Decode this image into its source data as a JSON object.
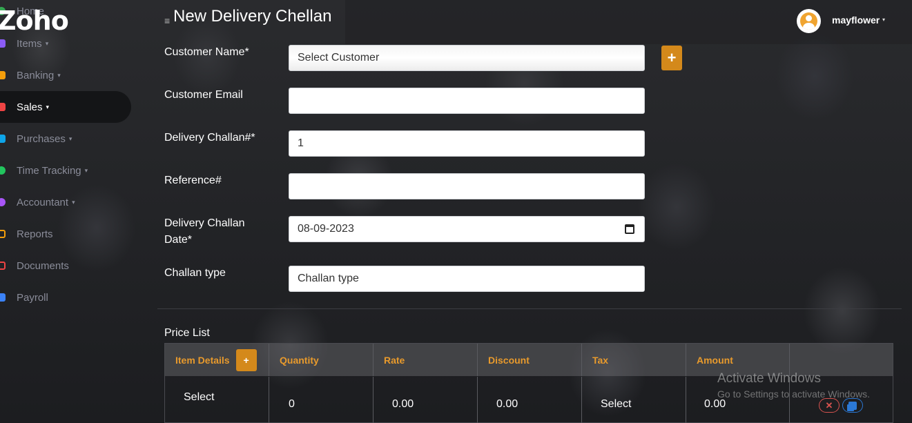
{
  "brand": "Zoho",
  "sidebar": {
    "items": [
      {
        "label": "Home",
        "caret": "",
        "icon": "home-icon",
        "color": "#35a853"
      },
      {
        "label": "Items",
        "caret": "▾",
        "icon": "items-icon",
        "color": "#8b5cf6"
      },
      {
        "label": "Banking",
        "caret": "▾",
        "icon": "bank-icon",
        "color": "#f59e0b"
      },
      {
        "label": "Sales",
        "caret": "▾",
        "icon": "sales-icon",
        "color": "#ef4444"
      },
      {
        "label": "Purchases",
        "caret": "▾",
        "icon": "cart-icon",
        "color": "#0ea5e9"
      },
      {
        "label": "Time Tracking",
        "caret": "▾",
        "icon": "clock-icon",
        "color": "#22c55e"
      },
      {
        "label": "Accountant",
        "caret": "▾",
        "icon": "user-icon",
        "color": "#a855f7"
      },
      {
        "label": "Reports",
        "caret": "",
        "icon": "calendar-icon",
        "color": "#f59e0b"
      },
      {
        "label": "Documents",
        "caret": "",
        "icon": "folder-icon",
        "color": "#ef4444"
      },
      {
        "label": "Payroll",
        "caret": "",
        "icon": "payroll-icon",
        "color": "#3b82f6"
      }
    ]
  },
  "header": {
    "menu_icon": "≡",
    "title": "New Delivery Chellan",
    "user": "mayflower",
    "user_caret": "▾"
  },
  "form": {
    "customer_name": {
      "label": "Customer Name*",
      "value": "Select Customer",
      "add": "+"
    },
    "customer_email": {
      "label": "Customer Email",
      "value": ""
    },
    "challan_no": {
      "label": "Delivery Challan#*",
      "value": "1"
    },
    "reference": {
      "label": "Reference#",
      "value": ""
    },
    "challan_date": {
      "label_line1": "Delivery Challan",
      "label_line2": "Date*",
      "value": "08-09-2023"
    },
    "challan_type": {
      "label": "Challan type",
      "value": "Challan type"
    }
  },
  "price_list": {
    "title": "Price List",
    "add": "+",
    "columns": [
      "Item Details",
      "Quantity",
      "Rate",
      "Discount",
      "Tax",
      "Amount"
    ],
    "row": {
      "item": "Select",
      "quantity": "0",
      "rate": "0.00",
      "discount": "0.00",
      "tax": "Select",
      "amount": "0.00",
      "remove": "✕"
    }
  },
  "watermark": {
    "title": "Activate Windows",
    "subtitle": "Go to Settings to activate Windows."
  },
  "colors": {
    "accent": "#d4891b",
    "header_text": "#e89a2c",
    "danger": "#d9534f",
    "primary": "#2b78d4"
  }
}
